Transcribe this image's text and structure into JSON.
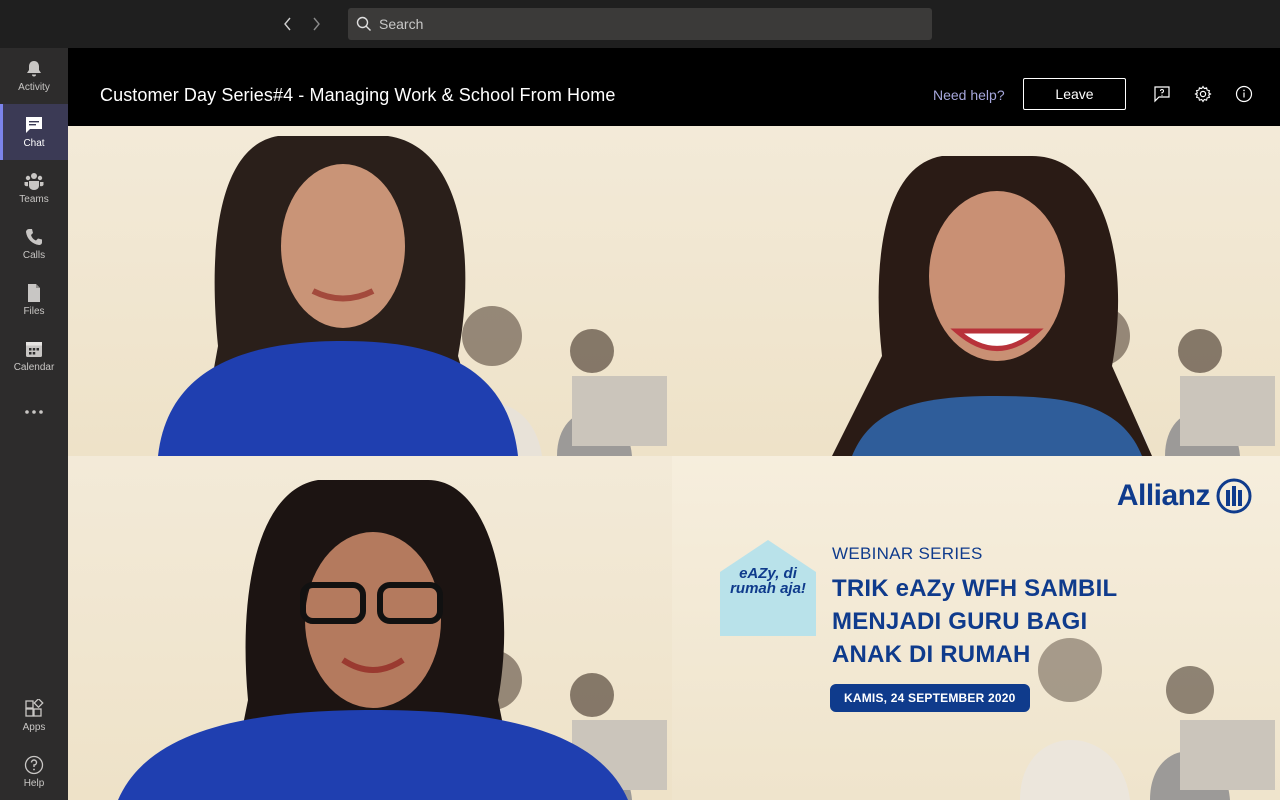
{
  "topbar": {
    "back_icon": "chevron-left-icon",
    "forward_icon": "chevron-right-icon",
    "search_placeholder": "Search"
  },
  "rail": {
    "items": [
      {
        "label": "Activity",
        "icon": "bell-icon"
      },
      {
        "label": "Chat",
        "icon": "chat-icon",
        "active": true
      },
      {
        "label": "Teams",
        "icon": "teams-icon"
      },
      {
        "label": "Calls",
        "icon": "phone-icon"
      },
      {
        "label": "Files",
        "icon": "file-icon"
      },
      {
        "label": "Calendar",
        "icon": "calendar-icon"
      }
    ],
    "bottom": [
      {
        "label": "Apps",
        "icon": "apps-icon"
      },
      {
        "label": "Help",
        "icon": "help-icon"
      }
    ]
  },
  "meeting": {
    "title": "Customer Day Series#4 - Managing Work & School From Home",
    "help_label": "Need help?",
    "leave_label": "Leave"
  },
  "banner": {
    "logo_text": "Allianz",
    "house_text": "eAZy, di rumah aja!",
    "series_label": "WEBINAR SERIES",
    "headline_lines": [
      "TRIK eAZy WFH SAMBIL",
      "MENJADI GURU BAGI",
      "ANAK DI RUMAH"
    ],
    "date": "KAMIS, 24 SEPTEMBER 2020"
  },
  "colors": {
    "accent": "#7b83eb",
    "brand_blue": "#0f3b8c",
    "rail_bg": "#2d2c2c",
    "topbar_bg": "#1f1f1f",
    "help_link": "#a6a7dc"
  }
}
